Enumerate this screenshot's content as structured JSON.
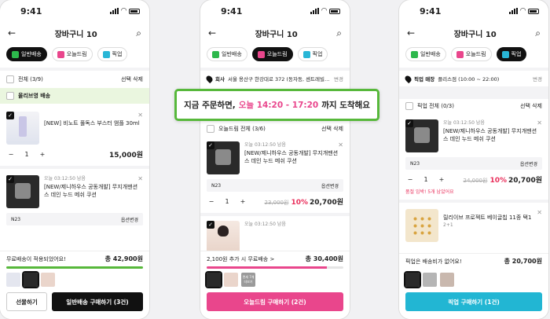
{
  "status_time": "9:41",
  "nav_title": "장바구니 10",
  "tabs": {
    "normal": "일반배송",
    "today": "오늘드림",
    "pickup": "픽업"
  },
  "colors": {
    "green": "#57b83b",
    "pink": "#e9468c",
    "cyan": "#22b6d3",
    "black": "#111111",
    "red": "#e9305c"
  },
  "banner": {
    "before": "지금 주문하면,",
    "highlight": "오늘 14:20 - 17:20",
    "after": "까지 도착해요"
  },
  "screen1": {
    "select_all": "전체 (3/9)",
    "delete_selected": "선택 삭제",
    "store_label": "올리브영 배송",
    "item1": {
      "name": "[NEW] 비노트 풀독스 부스터 앰플 30ml",
      "qty": "1",
      "price": "15,000원"
    },
    "item2": {
      "time": "오늘 03:12:50 남음",
      "name": "[NEW/제니하우스 공동개발] 무지개맨션 스 데인 누드 메쉬 쿠션",
      "option": "N23",
      "option_change": "옵션변경"
    },
    "free_ship": "무료배송이 적용되었어요!",
    "total": "총 42,900원",
    "gift_btn": "선물하기",
    "buy_btn": "일반배송 구매하기 (3건)"
  },
  "screen2": {
    "addr_label": "회사",
    "addr": "서울 용산구 한강대로 372 (동자동, 센트레빌아...",
    "addr_change": "변경",
    "select_all": "오늘드림 전체 (3/6)",
    "delete_selected": "선택 삭제",
    "item1": {
      "time": "오늘 03:12:50 남음",
      "name": "[NEW/제니하우스 공동개발] 무지개맨션 스 데인 누드 메쉬 쿠션",
      "option": "N23",
      "option_change": "옵션변경",
      "qty": "1",
      "orig": "23,000원",
      "pct": "10%",
      "price": "20,700원"
    },
    "item2": {
      "time": "오늘 03:12:50 남음"
    },
    "extra": "2,100원 추가 시 무료배송 >",
    "total": "총 30,400원",
    "progress": 0.88,
    "mini_label": "면세 7개 더보기",
    "buy_btn": "오늘드림 구매하기 (2건)"
  },
  "screen3": {
    "store_label": "픽업 매장",
    "store": "플리스점 (10:00 ~ 22:00)",
    "store_change": "변경",
    "select_all": "픽업 전체 (0/3)",
    "delete_selected": "선택 삭제",
    "item1": {
      "time": "오늘 03:12:50 남음",
      "name": "[NEW/제니하우스 공동개발] 무지개맨션 스 데인 누드 메쉬 쿠션",
      "option": "N23",
      "option_change": "옵션변경",
      "qty": "1",
      "orig": "24,000원",
      "pct": "10%",
      "price": "20,700원",
      "notice": "품절 임박! 5개 남았어요"
    },
    "item2": {
      "name": "릴리이브 프로젝트 베이글칩 11종 택1",
      "badge": "2+1"
    },
    "free_ship": "픽업은 배송비가 없어요!",
    "total": "총 20,700원",
    "buy_btn": "픽업 구매하기 (1건)"
  }
}
